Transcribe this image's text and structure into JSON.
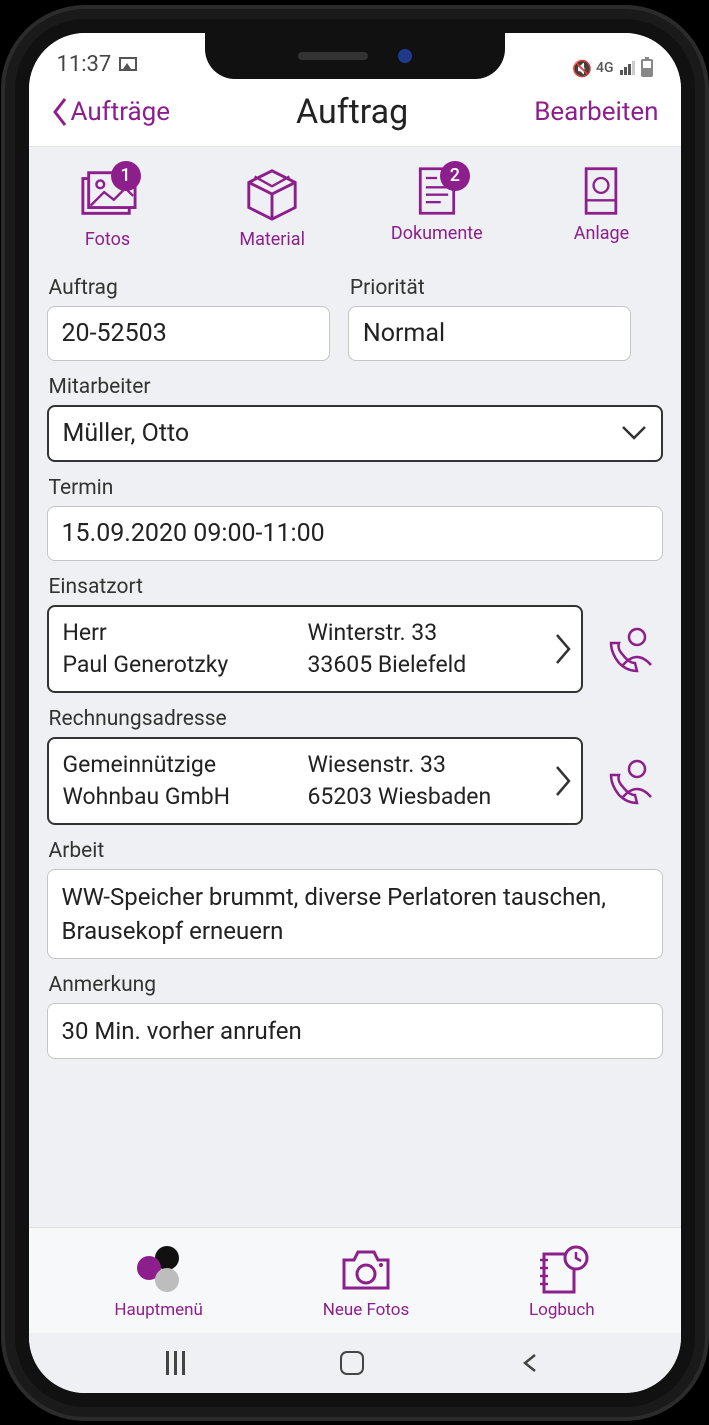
{
  "status": {
    "time": "11:37"
  },
  "nav": {
    "back": "Aufträge",
    "title": "Auftrag",
    "edit": "Bearbeiten"
  },
  "tabs": {
    "fotos": {
      "label": "Fotos",
      "badge": "1"
    },
    "material": {
      "label": "Material"
    },
    "dokumente": {
      "label": "Dokumente",
      "badge": "2"
    },
    "anlage": {
      "label": "Anlage"
    }
  },
  "form": {
    "auftrag_label": "Auftrag",
    "auftrag_value": "20-52503",
    "prioritaet_label": "Priorität",
    "prioritaet_value": "Normal",
    "mitarbeiter_label": "Mitarbeiter",
    "mitarbeiter_value": "Müller, Otto",
    "termin_label": "Termin",
    "termin_value": "15.09.2020 09:00-11:00",
    "einsatzort_label": "Einsatzort",
    "einsatzort": {
      "name1": "Herr",
      "name2": "Paul Generotzky",
      "addr1": "Winterstr. 33",
      "addr2": "33605 Bielefeld"
    },
    "rechnung_label": "Rechnungsadresse",
    "rechnung": {
      "name1": "Gemeinnützige",
      "name2": "Wohnbau GmbH",
      "addr1": "Wiesenstr. 33",
      "addr2": "65203 Wiesbaden"
    },
    "arbeit_label": "Arbeit",
    "arbeit_value": "WW-Speicher brummt, diverse Perlatoren tauschen, Brausekopf erneuern",
    "anmerkung_label": "Anmerkung",
    "anmerkung_value": "30 Min. vorher anrufen"
  },
  "bottom": {
    "haupt": "Hauptmenü",
    "fotos": "Neue Fotos",
    "log": "Logbuch"
  },
  "colors": {
    "accent": "#8d1f8d"
  }
}
